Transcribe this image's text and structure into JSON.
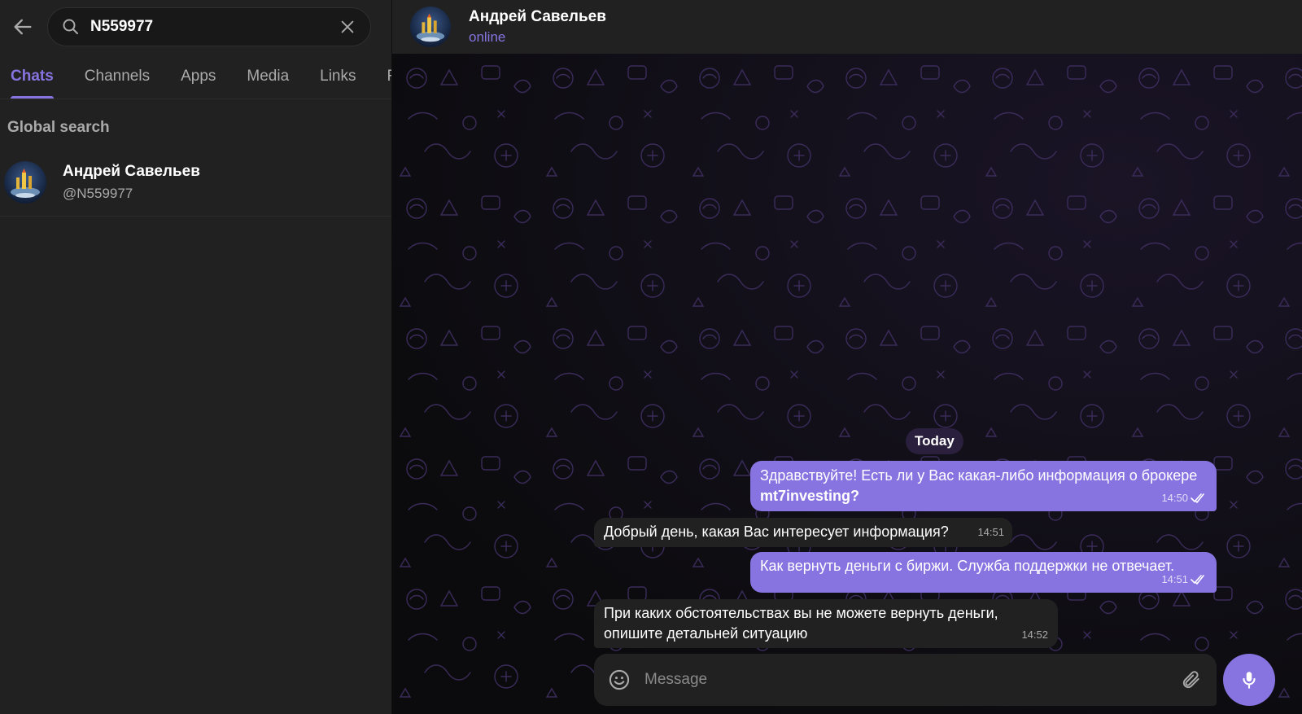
{
  "search": {
    "query": "N559977"
  },
  "tabs": [
    {
      "label": "Chats",
      "active": true
    },
    {
      "label": "Channels",
      "active": false
    },
    {
      "label": "Apps",
      "active": false
    },
    {
      "label": "Media",
      "active": false
    },
    {
      "label": "Links",
      "active": false
    },
    {
      "label": "F",
      "active": false
    }
  ],
  "results": {
    "section_title": "Global search",
    "items": [
      {
        "name": "Андрей Савельев",
        "username": "@N559977"
      }
    ]
  },
  "chat": {
    "name": "Андрей Савельев",
    "status": "online",
    "date_label": "Today",
    "messages": [
      {
        "dir": "out",
        "text": "Здравствуйте! Есть ли у Вас какая-либо информация о брокере ",
        "bold": "mt7investing?",
        "time": "14:50",
        "read": true
      },
      {
        "dir": "in",
        "text": "Добрый день, какая Вас интересует информация?",
        "time": "14:51"
      },
      {
        "dir": "out",
        "text": "Как вернуть деньги с биржи. Служба поддержки не отвечает.",
        "time": "14:51",
        "read": true
      },
      {
        "dir": "in",
        "text": "При каких обстоятельствах вы не можете вернуть деньги, опишите детальней ситуацию",
        "time": "14:52"
      }
    ],
    "composer_placeholder": "Message"
  },
  "colors": {
    "accent": "#8774e1",
    "panel": "#212121",
    "background": "#181818",
    "secondary_text": "#aaaaaa"
  },
  "icons": [
    "back-arrow-icon",
    "search-icon",
    "close-icon",
    "emoji-icon",
    "paperclip-icon",
    "microphone-icon",
    "double-check-icon"
  ]
}
